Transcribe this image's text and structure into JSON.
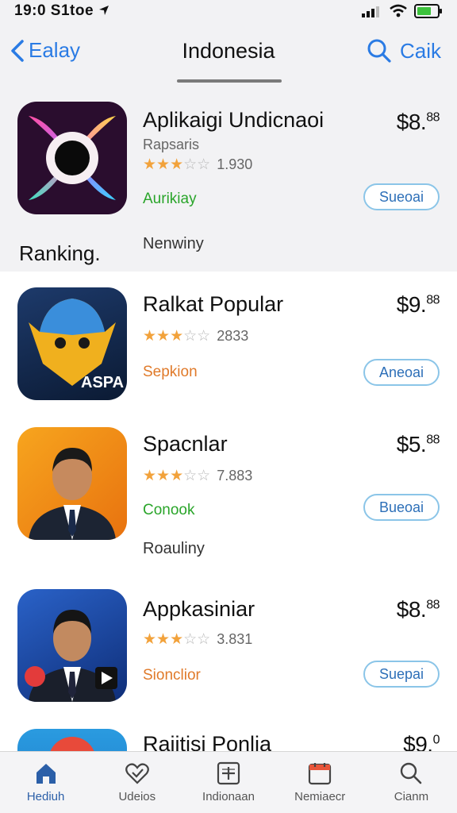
{
  "status_bar": {
    "time": "19:0 S1toe"
  },
  "nav": {
    "back_label": "Ealay",
    "title": "Indonesia",
    "search_label": "Caik"
  },
  "apps": [
    {
      "name": "Aplikaigi Undicnaoi",
      "subtitle": "Rapsaris",
      "rating": 3,
      "rating_count": "1.930",
      "tag": "Aurikiay",
      "tag_color": "#2aa52a",
      "price": "$8.",
      "price_cents": "88",
      "button": "Sueoai",
      "caption": "Nenwiny"
    },
    {
      "name": "Ralkat Popular",
      "rating": 3,
      "rating_count": "2833",
      "tag": "Sepkion",
      "tag_color": "#e07a2a",
      "price": "$9.",
      "price_cents": "88",
      "button": "Aneoai",
      "icon_text": "ASPA"
    },
    {
      "name": "Spacnlar",
      "rating": 3,
      "rating_count": "7.883",
      "tag": "Conook",
      "tag_color": "#2aa52a",
      "price": "$5.",
      "price_cents": "88",
      "button": "Bueoai",
      "caption": "Roauliny"
    },
    {
      "name": "Appkasiniar",
      "rating": 3,
      "rating_count": "3.831",
      "tag": "Sionclior",
      "tag_color": "#e07a2a",
      "price": "$8.",
      "price_cents": "88",
      "button": "Suepai"
    },
    {
      "name": "Rajitisi Ponlia",
      "price": "$9.",
      "price_cents": "0"
    }
  ],
  "ranking_label": "Ranking.",
  "tab_bar": [
    {
      "label": "Hediuh",
      "icon": "home-icon"
    },
    {
      "label": "Udeios",
      "icon": "heart-check-icon"
    },
    {
      "label": "Indionaan",
      "icon": "plus-square-icon"
    },
    {
      "label": "Nemiaecr",
      "icon": "calendar-icon"
    },
    {
      "label": "Cianm",
      "icon": "search-icon"
    }
  ],
  "colors": {
    "accent": "#2a7be4",
    "star": "#f2a23b",
    "button_border": "#8bc5e8"
  }
}
